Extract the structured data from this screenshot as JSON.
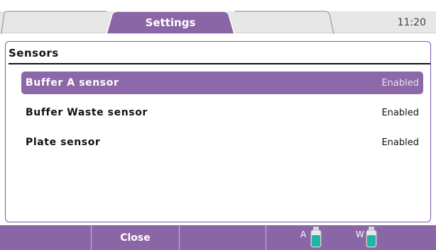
{
  "header": {
    "tab_title": "Settings",
    "clock": "11:20"
  },
  "panel": {
    "title": "Sensors",
    "rows": [
      {
        "name": "Buffer A sensor",
        "status": "Enabled",
        "selected": true
      },
      {
        "name": "Buffer Waste sensor",
        "status": "Enabled",
        "selected": false
      },
      {
        "name": "Plate sensor",
        "status": "Enabled",
        "selected": false
      }
    ]
  },
  "footer": {
    "close_label": "Close",
    "bottles": [
      {
        "label": "A",
        "icon": "bottle-icon",
        "color": "#20b3a7"
      },
      {
        "label": "W",
        "icon": "bottle-icon",
        "color": "#20b3a7"
      }
    ]
  },
  "colors": {
    "accent": "#8a66a6",
    "tab_background": "#e7e7e7",
    "bottle_fill": "#20b3a7"
  }
}
